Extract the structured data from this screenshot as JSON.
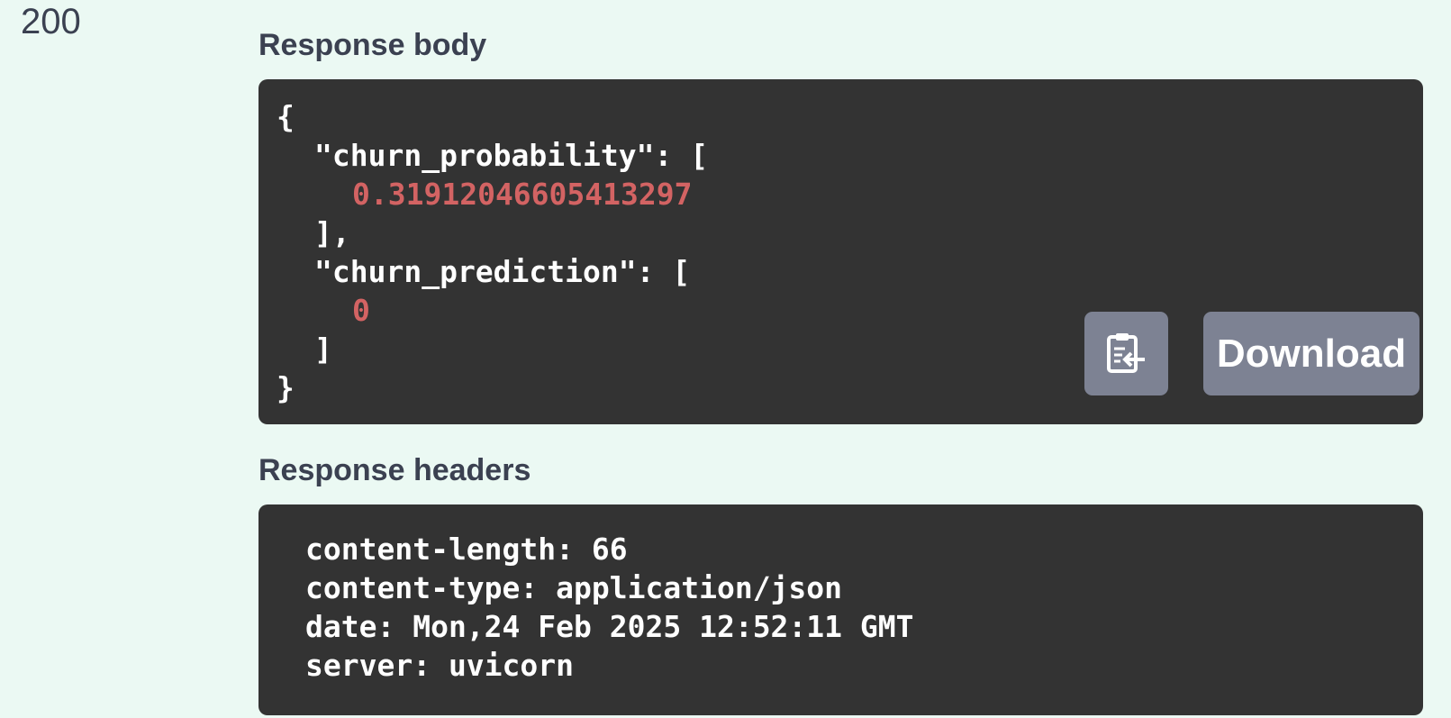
{
  "response": {
    "status_code": "200",
    "body_title": "Response body",
    "headers_title": "Response headers",
    "body_lines": {
      "l0": "{",
      "l1": "\"churn_probability\": [",
      "l2": "0.31912046605413297",
      "l3": "],",
      "l4": "\"churn_prediction\": [",
      "l5": "0",
      "l6": "]",
      "l7": "}"
    },
    "headers": [
      "content-length: 66",
      "content-type: application/json",
      "date: Mon,24 Feb 2025 12:52:11 GMT",
      "server: uvicorn"
    ],
    "buttons": {
      "copy_icon": "clipboard-copy-icon",
      "download_label": "Download"
    }
  },
  "colors": {
    "page_background": "#ebf9f3",
    "code_background": "#333333",
    "number_color": "#d36363",
    "button_background": "#7d8293",
    "heading_color": "#3b4151"
  }
}
